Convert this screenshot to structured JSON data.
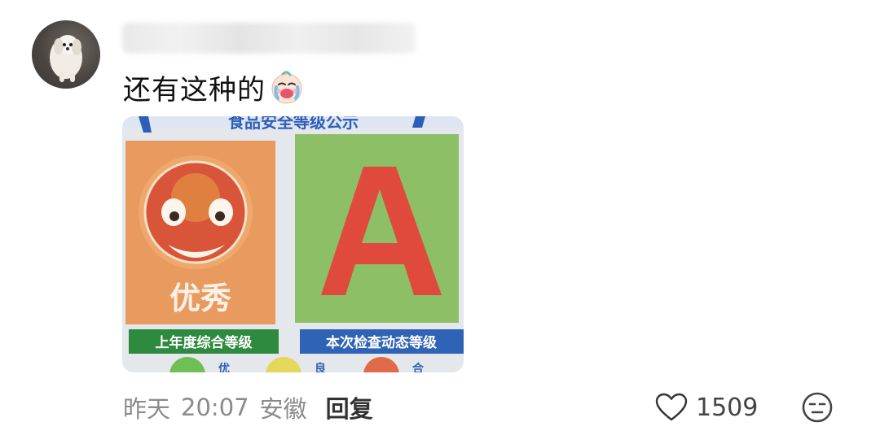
{
  "comment": {
    "text": "还有这种的",
    "emoji_icon": "crying-face-icon",
    "photo": {
      "banner_text": "食品安全等级公示",
      "left_card": {
        "word": "优秀",
        "label": "上年度综合等级",
        "color": "#e89a5c"
      },
      "right_card": {
        "letter": "A",
        "label": "本次检查动态等级",
        "color": "#8fc06a"
      },
      "bottom_fragments": [
        "优",
        "良",
        "合"
      ]
    },
    "meta": {
      "date": "昨天",
      "time": "20:07",
      "location": "安徽",
      "reply_label": "回复"
    },
    "likes": {
      "icon": "heart-outline-icon",
      "count": "1509"
    },
    "reaction_icon": "neutral-face-icon"
  }
}
